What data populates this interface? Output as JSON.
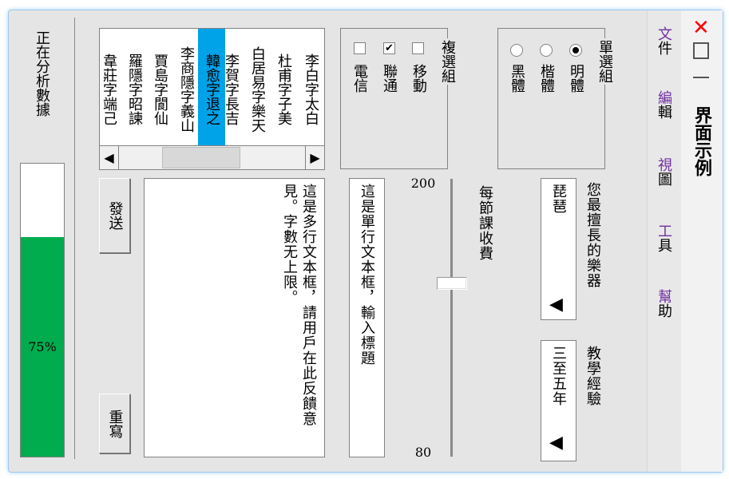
{
  "title_bar": {
    "title": "界面示例",
    "close_icon": "close-icon",
    "maximize_icon": "maximize-icon",
    "minimize_icon": "minimize-icon"
  },
  "menu": [
    {
      "first": "文",
      "rest": "件"
    },
    {
      "first": "編",
      "rest": "輯"
    },
    {
      "first": "視",
      "rest": "圖"
    },
    {
      "first": "工",
      "rest": "具"
    },
    {
      "first": "幫",
      "rest": "助"
    }
  ],
  "colors": {
    "accent": "#7030a0",
    "selection": "#00a2e8",
    "progress": "#00ac4e",
    "close": "#ff0000"
  },
  "radio_group": {
    "legend": "單選組",
    "options": [
      {
        "label": "明體",
        "checked": true
      },
      {
        "label": "楷體",
        "checked": false
      },
      {
        "label": "黑體",
        "checked": false
      }
    ]
  },
  "check_group": {
    "legend": "複選組",
    "options": [
      {
        "label": "移動",
        "checked": false
      },
      {
        "label": "聯通",
        "checked": true
      },
      {
        "label": "電信",
        "checked": false
      }
    ]
  },
  "list": {
    "items": [
      "李白字太白",
      "杜甫字子美",
      "白居易字樂天",
      "李賀字長吉",
      "韓愈字退之",
      "李商隱字義山",
      "賈島字閬仙",
      "羅隱字昭諫",
      "韋莊字端己"
    ],
    "selected_index": 4
  },
  "instrument": {
    "label": "您最擅長的樂器",
    "value": "琵琶"
  },
  "experience": {
    "label": "教學經驗",
    "value": "三至五年"
  },
  "slider": {
    "label": "每節課收費",
    "max_label": "200",
    "min_label": "80",
    "max": 200,
    "min": 80,
    "value": 155
  },
  "single_line": {
    "value": "這是單行文本框，輸入標題"
  },
  "multi_line": {
    "value": "這是多行文本框，請用戶在此反饋意見。字數无上限。"
  },
  "buttons": {
    "send": "發送",
    "reset": "重寫"
  },
  "progress": {
    "label": "正在分析數據",
    "value_text": "75%",
    "value": 0.75
  }
}
